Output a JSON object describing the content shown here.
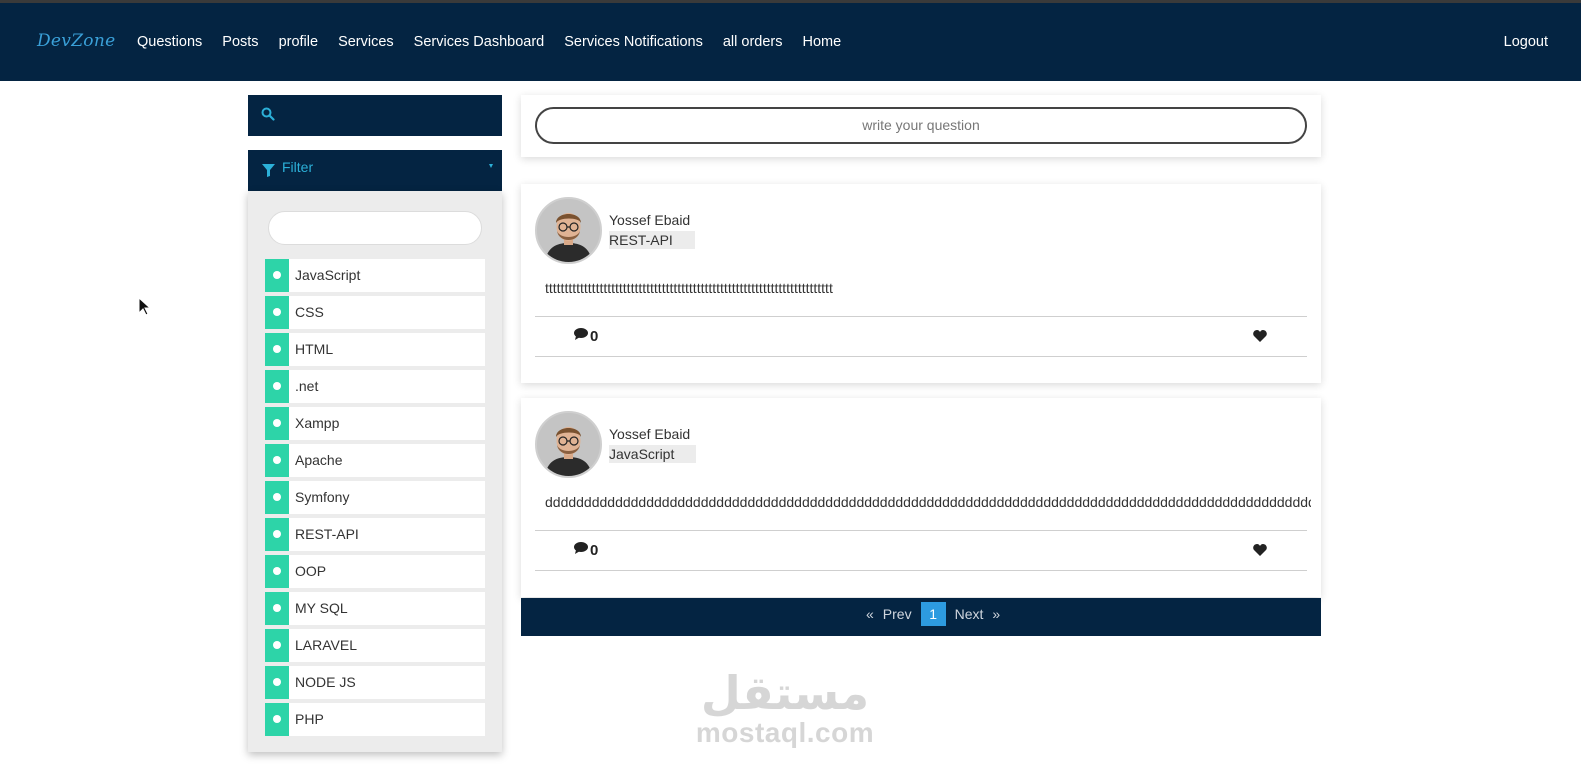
{
  "navbar": {
    "brand": "DevZone",
    "links": [
      "Questions",
      "Posts",
      "profile",
      "Services",
      "Services Dashboard",
      "Services Notifications",
      "all orders",
      "Home"
    ],
    "logout": "Logout"
  },
  "sidebar": {
    "search_icon": "search-icon",
    "filter_label": "Filter",
    "filter_icon": "filter-icon",
    "tags": [
      "JavaScript",
      "CSS",
      "HTML",
      ".net",
      "Xampp",
      "Apache",
      "Symfony",
      "REST-API",
      "OOP",
      "MY SQL",
      "LARAVEL",
      "NODE JS",
      "PHP"
    ]
  },
  "ask": {
    "placeholder": "write your question"
  },
  "posts": [
    {
      "author": "Yossef Ebaid",
      "tag": "REST-API",
      "body": "tttttttttttttttttttttttttttttttttttttttttttttttttttttttttttttttttttttttttt",
      "comments": "0"
    },
    {
      "author": "Yossef Ebaid",
      "tag": "JavaScript",
      "body": "dddddddddddddddddddddddddddddddddddddddddddddddddddddddddddddddddddddddddddddddddddddddddddddddddddddd",
      "comments": "0"
    }
  ],
  "pagination": {
    "prev_arrow": "«",
    "prev": "Prev",
    "current": "1",
    "next": "Next",
    "next_arrow": "»"
  },
  "watermark": {
    "arabic": "مستقل",
    "latin": "mostaql.com"
  },
  "colors": {
    "navbar": "#042442",
    "accent": "#2dd4a8",
    "brand": "#3aa0d8",
    "page_active": "#2d9be0"
  }
}
